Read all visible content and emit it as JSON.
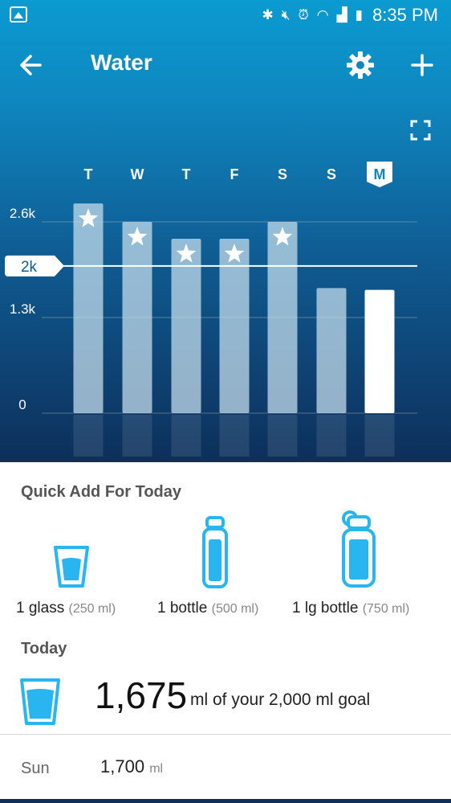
{
  "status_bar": {
    "time": "8:35 PM",
    "icons": [
      "image-icon",
      "bluetooth-icon",
      "mute-icon",
      "alarm-icon",
      "wifi-icon",
      "signal-icon",
      "battery-icon"
    ]
  },
  "app_bar": {
    "title": "Water",
    "back_icon": "back-arrow-icon",
    "settings_icon": "gear-icon",
    "add_icon": "plus-icon",
    "expand_icon": "expand-icon"
  },
  "colors": {
    "gradient_top": "#0a9bd1",
    "gradient_bottom": "#0d2f5a",
    "accent_blue": "#29b6f0",
    "bar": "#a9cbe0",
    "today_bar": "#ffffff"
  },
  "chart_data": {
    "type": "bar",
    "categories": [
      "T",
      "W",
      "T",
      "F",
      "S",
      "S",
      "M"
    ],
    "selected_category": "M",
    "values": [
      2850,
      2600,
      2370,
      2370,
      2600,
      1700,
      1675
    ],
    "goal_met": [
      true,
      true,
      true,
      true,
      true,
      false,
      false
    ],
    "goal": 2000,
    "goal_label": "2k",
    "y_ticks": [
      {
        "value": 0,
        "label": "0"
      },
      {
        "value": 1300,
        "label": "1.3k"
      },
      {
        "value": 2600,
        "label": "2.6k"
      }
    ],
    "ylim": [
      0,
      2900
    ],
    "grid": true
  },
  "quick_add": {
    "title": "Quick Add For Today",
    "items": [
      {
        "name": "1 glass",
        "size": "(250 ml)",
        "icon": "glass-icon"
      },
      {
        "name": "1 bottle",
        "size": "(500 ml)",
        "icon": "bottle-icon"
      },
      {
        "name": "1 lg bottle",
        "size": "(750 ml)",
        "icon": "large-bottle-icon"
      }
    ]
  },
  "today": {
    "title": "Today",
    "amount": "1,675",
    "goal_text": "ml of your 2,000 ml goal"
  },
  "history": [
    {
      "day": "Sun",
      "value": "1,700",
      "unit": "ml"
    }
  ]
}
